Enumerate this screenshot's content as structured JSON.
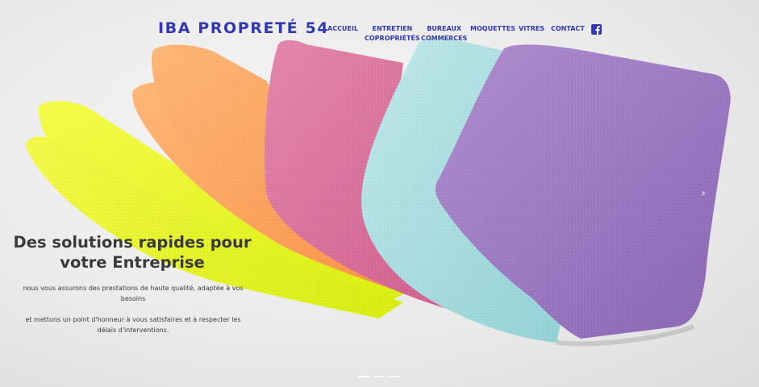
{
  "site": {
    "logo": "IBA PROPRETÉ 54"
  },
  "nav": {
    "items": [
      {
        "line1": "ACCUEIL",
        "line2": ""
      },
      {
        "line1": "ENTRETIEN",
        "line2": "COPROPRIÉTÉS"
      },
      {
        "line1": "BUREAUX",
        "line2": "COMMERCES"
      },
      {
        "line1": "MOQUETTES",
        "line2": ""
      },
      {
        "line1": "VITRES",
        "line2": ""
      },
      {
        "line1": "CONTACT",
        "line2": ""
      }
    ],
    "social_icon": "facebook-icon"
  },
  "hero": {
    "headline_line1": "Des solutions rapides pour",
    "headline_line2": "votre Entreprise",
    "paragraph1_line1": "nous vous assurons des prestations de haute qualité, adaptée à vos",
    "paragraph1_line2": "besoins",
    "paragraph2_line1": "et mettons un point d'honneur à vous satisfaires et à respecter les",
    "paragraph2_line2": "délais d'interventions.",
    "prev_arrow": "‹",
    "next_arrow": "›",
    "slides": 3,
    "active_slide": 1
  },
  "colors": {
    "accent": "#3038b4",
    "text": "#3a3a3a",
    "cloth_yellow": "#e8f52a",
    "cloth_orange": "#fca55c",
    "cloth_pink": "#db6c98",
    "cloth_blue": "#a9dde0",
    "cloth_purple": "#9f7bc2"
  }
}
